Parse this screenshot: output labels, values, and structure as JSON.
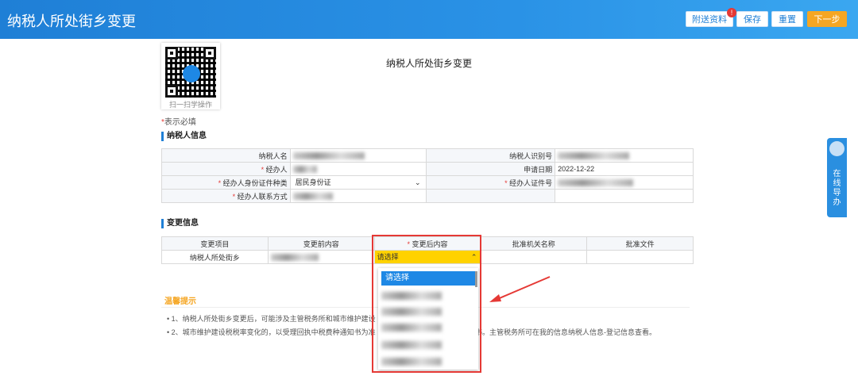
{
  "header": {
    "title": "纳税人所处街乡变更",
    "buttons": {
      "attach": "附送资料",
      "attach_badge": "!",
      "save": "保存",
      "reset": "重置",
      "next": "下一步"
    }
  },
  "qr": {
    "caption": "扫一扫学操作"
  },
  "page_title": "纳税人所处街乡变更",
  "required_note": {
    "star": "*",
    "text": "表示必填"
  },
  "taxpayer_section": {
    "title": "纳税人信息",
    "labels": {
      "name": "纳税人名",
      "agent": "经办人",
      "id_type": "经办人身份证件种类",
      "contact": "经办人联系方式",
      "tax_id": "纳税人识别号",
      "apply_date": "申请日期",
      "id_number": "经办人证件号"
    },
    "values": {
      "id_type": "居民身份证",
      "apply_date": "2022-12-22"
    },
    "star": "*"
  },
  "change_section": {
    "title": "变更信息",
    "columns": [
      "变更项目",
      "变更前内容",
      "变更后内容",
      "批准机关名称",
      "批准文件"
    ],
    "row": {
      "item": "纳税人所处街乡",
      "selected": "请选择"
    },
    "dropdown": {
      "first_option": "请选择"
    }
  },
  "tips": {
    "title": "温馨提示",
    "items": [
      "•   1、纳税人所处街乡变更后，可能涉及主管税务所和城市维护建设",
      "•   2、城市维护建设税税率变化的，以受理回执中税费种通知书为准",
      "书。主管税务所可在我的信息纳税人信息-登记信息查看。"
    ]
  },
  "side_nav": {
    "label": "在线导办"
  }
}
